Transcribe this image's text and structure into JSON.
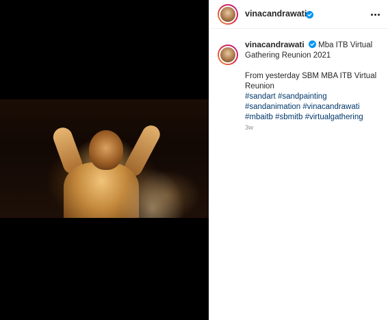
{
  "header": {
    "username": "vinacandrawati",
    "verified": true
  },
  "caption": {
    "username": "vinacandrawati",
    "title_text": "Mba ITB Virtual Gathering Reunion 2021",
    "body_text": "From yesterday SBM MBA ITB Virtual Reunion",
    "hashtags": [
      "#sandart",
      "#sandpainting",
      "#sandanimation",
      "#vinacandrawati",
      "#mbaitb",
      "#sbmitb",
      "#virtualgathering"
    ],
    "timestamp": "3w"
  },
  "colors": {
    "verified_blue": "#0095f6",
    "hashtag_blue": "#00376b",
    "muted_gray": "#8e8e8e"
  },
  "icons": {
    "more": "more-options-icon",
    "verified": "verified-badge-icon"
  }
}
